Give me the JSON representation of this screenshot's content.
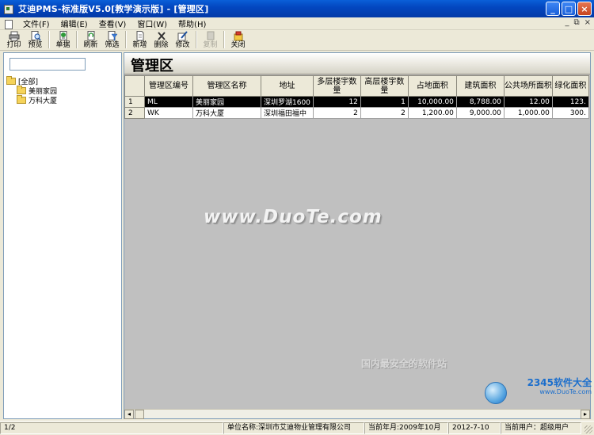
{
  "window": {
    "title": "艾迪PMS-标准版V5.0[教学演示版] - [管理区]",
    "controls": {
      "minimize": "_",
      "maximize": "□",
      "close": "×"
    }
  },
  "menubar": {
    "items": [
      "文件(F)",
      "编辑(E)",
      "查看(V)",
      "窗口(W)",
      "帮助(H)"
    ],
    "mdi_controls": [
      "_",
      "⧉",
      "×"
    ]
  },
  "toolbar": {
    "buttons": [
      {
        "label": "打印",
        "icon": "printer-icon",
        "enabled": true
      },
      {
        "label": "预览",
        "icon": "preview-icon",
        "enabled": true
      },
      {
        "label": "单据",
        "icon": "document-icon",
        "enabled": true
      },
      {
        "label": "刷新",
        "icon": "refresh-icon",
        "enabled": true
      },
      {
        "label": "筛选",
        "icon": "filter-icon",
        "enabled": true
      },
      {
        "label": "新增",
        "icon": "new-icon",
        "enabled": true
      },
      {
        "label": "删除",
        "icon": "delete-icon",
        "enabled": true
      },
      {
        "label": "修改",
        "icon": "edit-icon",
        "enabled": true
      },
      {
        "label": "复制",
        "icon": "copy-icon",
        "enabled": false
      },
      {
        "label": "关闭",
        "icon": "close-icon",
        "enabled": true
      }
    ]
  },
  "tree": {
    "search_value": "",
    "root": "[全部]",
    "children": [
      "美丽家园",
      "万科大厦"
    ]
  },
  "main": {
    "title": "管理区",
    "columns": [
      "",
      "管理区编号",
      "管理区名称",
      "地址",
      "多层楼宇数量",
      "高层楼宇数量",
      "占地面积",
      "建筑面积",
      "公共场所面积",
      "绿化面积"
    ],
    "rows": [
      [
        "1",
        "ML",
        "美丽家园",
        "深圳罗湖1600",
        "12",
        "1",
        "10,000.00",
        "8,788.00",
        "12.00",
        "123."
      ],
      [
        "2",
        "WK",
        "万科大厦",
        "深圳福田福中",
        "2",
        "2",
        "1,200.00",
        "9,000.00",
        "1,000.00",
        "300."
      ]
    ],
    "selected_row": 1,
    "watermark": "www.DuoTe.com"
  },
  "corner_logo": {
    "brand": "2345软件大全",
    "url": "www.DuoTe.com",
    "slogan": "国内最安全的软件站"
  },
  "statusbar": {
    "page": "1/2",
    "company": "单位名称:深圳市艾迪物业管理有限公司",
    "period": "当前年月:2009年10月",
    "date": "2012-7-10",
    "user": "当前用户：超级用户"
  }
}
